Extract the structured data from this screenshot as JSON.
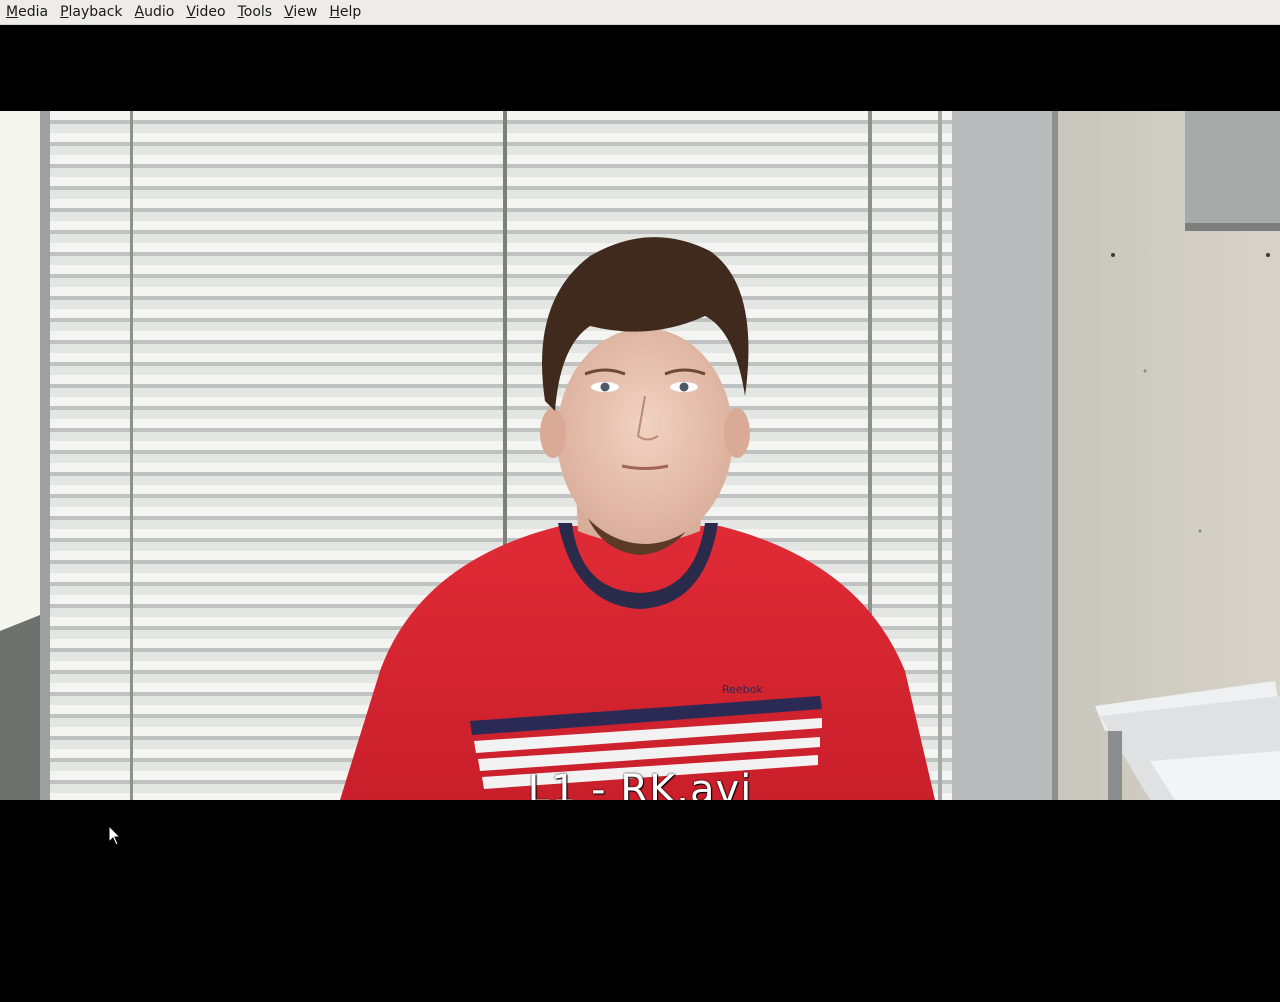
{
  "window": {
    "app": "VLC media player"
  },
  "menubar": {
    "items": [
      {
        "label": "Media",
        "mnemonic": "M",
        "rest": "edia"
      },
      {
        "label": "Playback",
        "mnemonic": "P",
        "rest": "layback"
      },
      {
        "label": "Audio",
        "mnemonic": "A",
        "rest": "udio"
      },
      {
        "label": "Video",
        "mnemonic": "V",
        "rest": "ideo"
      },
      {
        "label": "Tools",
        "mnemonic": "T",
        "rest": "ools"
      },
      {
        "label": "View",
        "mnemonic": "V",
        "rest": "iew"
      },
      {
        "label": "Help",
        "mnemonic": "H",
        "rest": "elp"
      }
    ]
  },
  "video": {
    "osd_title": "L1 - RK.avi",
    "shirt_logo": "Reebok"
  },
  "colors": {
    "menubar_bg": "#edeceb",
    "video_bg": "#000000",
    "shirt_red": "#d8232f"
  },
  "icons": [
    "mouse-pointer-icon"
  ]
}
